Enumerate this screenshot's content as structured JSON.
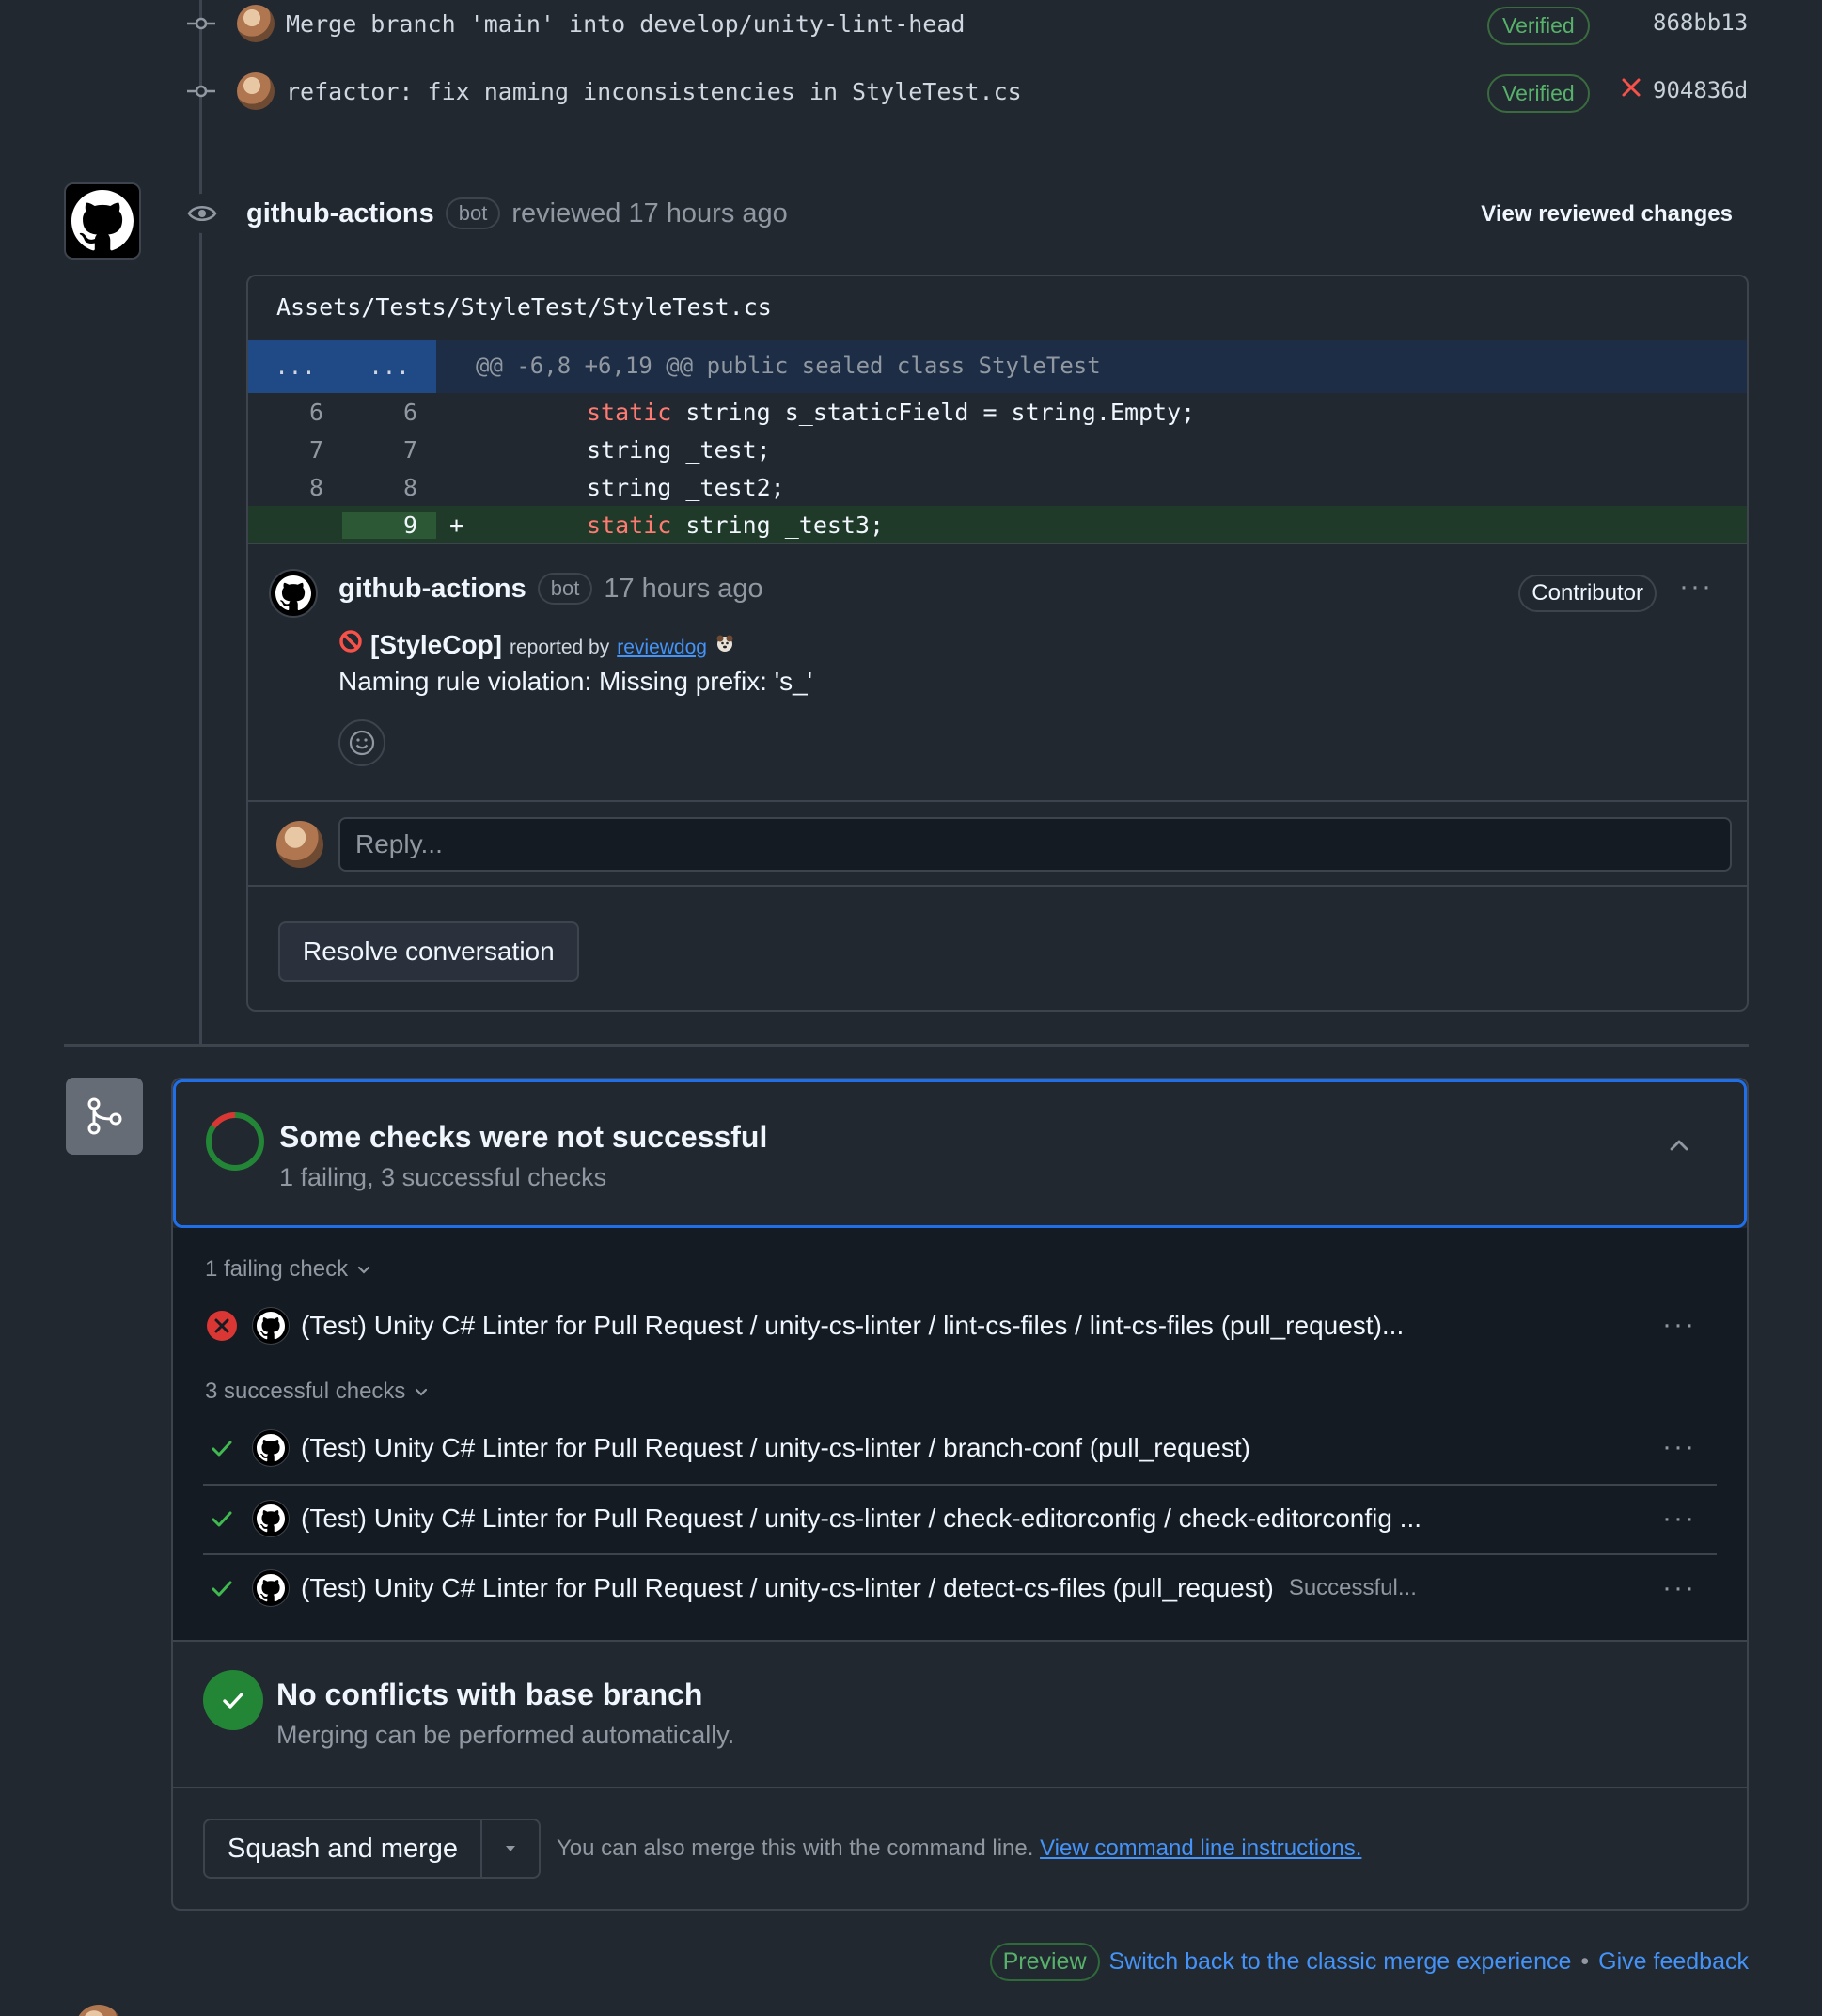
{
  "commits": [
    {
      "message": "Merge branch 'main' into develop/unity-lint-head",
      "badge": "Verified",
      "sha": "868bb13",
      "failed": false
    },
    {
      "message": "refactor: fix naming inconsistencies in StyleTest.cs",
      "badge": "Verified",
      "sha": "904836d",
      "failed": true
    }
  ],
  "review": {
    "author": "github-actions",
    "bot_label": "bot",
    "action": "reviewed 17 hours ago",
    "view_changes": "View reviewed changes",
    "file_path": "Assets/Tests/StyleTest/StyleTest.cs",
    "hunk_left": "...",
    "hunk_right": "...",
    "hunk_header": "@@ -6,8 +6,19 @@ public sealed class StyleTest",
    "lines": [
      {
        "old": "6",
        "new": "6",
        "kw": "static",
        "code": " string s_staticField = string.Empty;"
      },
      {
        "old": "7",
        "new": "7",
        "kw": "",
        "code": "string _test;"
      },
      {
        "old": "8",
        "new": "8",
        "kw": "",
        "code": "string _test2;"
      },
      {
        "old": "",
        "new": "9",
        "sign": "+",
        "kw": "static",
        "code": " string _test3;"
      }
    ],
    "comment": {
      "author": "github-actions",
      "bot_label": "bot",
      "time": "17 hours ago",
      "role": "Contributor",
      "tag": "[StyleCop]",
      "reported_by": "reported by",
      "reporter": "reviewdog",
      "body": "Naming rule violation: Missing prefix: 's_'"
    },
    "reply_placeholder": "Reply...",
    "resolve_label": "Resolve conversation"
  },
  "checks": {
    "title": "Some checks were not successful",
    "subtitle": "1 failing, 3 successful checks",
    "failing_label": "1 failing check",
    "failing": [
      {
        "name": "(Test) Unity C# Linter for Pull Request / unity-cs-linter / lint-cs-files / lint-cs-files (pull_request)...",
        "extra": ""
      }
    ],
    "successful_label": "3 successful checks",
    "successful": [
      {
        "name": "(Test) Unity C# Linter for Pull Request / unity-cs-linter / branch-conf (pull_request)",
        "extra": ""
      },
      {
        "name": "(Test) Unity C# Linter for Pull Request / unity-cs-linter / check-editorconfig / check-editorconfig ...",
        "extra": ""
      },
      {
        "name": "(Test) Unity C# Linter for Pull Request / unity-cs-linter / detect-cs-files (pull_request)",
        "extra": "Successful..."
      }
    ],
    "more_label": "..."
  },
  "conflicts": {
    "title": "No conflicts with base branch",
    "subtitle": "Merging can be performed automatically."
  },
  "merge": {
    "button": "Squash and merge",
    "hint": "You can also merge this with the command line.",
    "hint_link": "View command line instructions."
  },
  "footer": {
    "preview": "Preview",
    "switch_back": "Switch back to the classic merge experience",
    "separator": "•",
    "feedback": "Give feedback"
  },
  "colors": {
    "background": "#212830",
    "accent_blue": "#1f6feb",
    "success_green": "#238636",
    "fail_red": "#da3633",
    "link": "#4493f8"
  }
}
